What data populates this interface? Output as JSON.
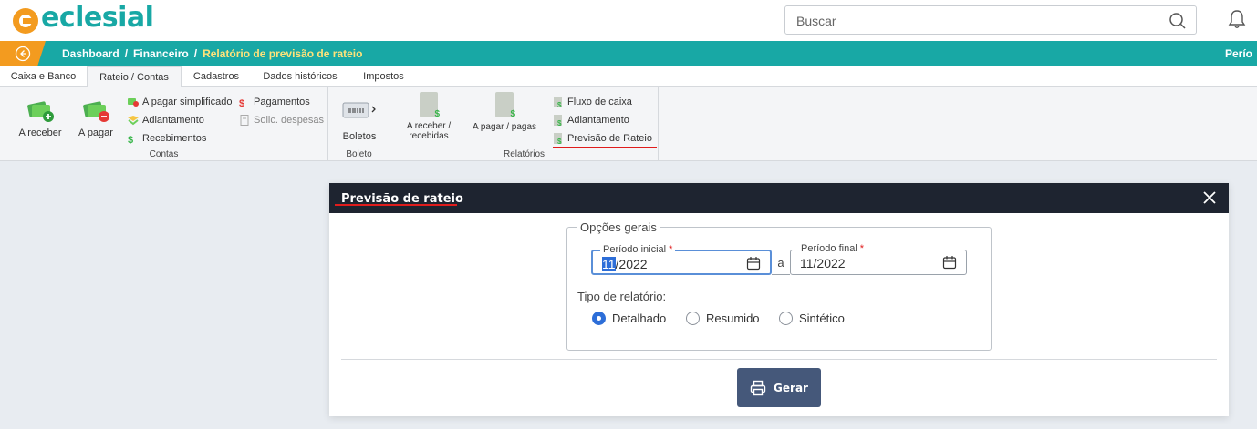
{
  "app": {
    "logo_text": "eclesial",
    "brand_teal": "#18a8a5",
    "brand_orange": "#f39b1f"
  },
  "search": {
    "placeholder": "Buscar"
  },
  "breadcrumb": {
    "items": [
      "Dashboard",
      "Financeiro",
      "Relatório de previsão de rateio"
    ],
    "separator": "/",
    "right_text": "Perío"
  },
  "ribbon": {
    "tabs": [
      "Caixa e Banco",
      "Rateio / Contas",
      "Cadastros",
      "Dados históricos",
      "Impostos"
    ],
    "active_tab": "Rateio / Contas",
    "groups": {
      "contas": {
        "label": "Contas",
        "a_receber": "A receber",
        "a_pagar": "A pagar",
        "a_pagar_simplificado": "A pagar simplificado",
        "adiantamento": "Adiantamento",
        "recebimentos": "Recebimentos",
        "pagamentos": "Pagamentos",
        "solic_despesas": "Solic. despesas"
      },
      "boleto": {
        "label": "Boleto",
        "boletos": "Boletos"
      },
      "relatorios": {
        "label": "Relatórios",
        "a_receber_recebidas_line1": "A receber /",
        "a_receber_recebidas_line2": "recebidas",
        "a_pagar_pagas": "A pagar / pagas",
        "fluxo_de_caixa": "Fluxo de caixa",
        "adiantamento": "Adiantamento",
        "previsao_de_rateio": "Previsão de Rateio"
      }
    }
  },
  "modal": {
    "title": "Previsão de rateio",
    "fieldset_legend": "Opções gerais",
    "periodo_inicial": {
      "label": "Período inicial",
      "required": "*",
      "month_selected": "11",
      "rest": "/2022"
    },
    "separator": "a",
    "periodo_final": {
      "label": "Período final",
      "required": "*",
      "value": "11/2022"
    },
    "tipo_label": "Tipo de relatório:",
    "tipo_options": [
      "Detalhado",
      "Resumido",
      "Sintético"
    ],
    "tipo_selected": "Detalhado",
    "submit_label": "Gerar"
  }
}
